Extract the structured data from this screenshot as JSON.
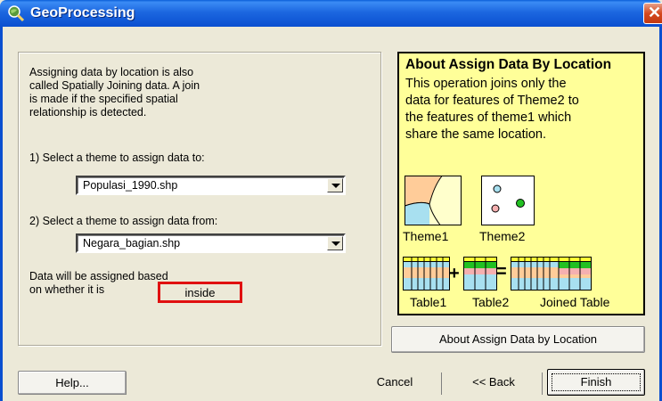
{
  "window": {
    "title": "GeoProcessing",
    "close_glyph": "✕"
  },
  "left_panel": {
    "intro_lines": [
      "Assigning data by location is also",
      "called Spatially Joining data.  A join",
      "is made if the specified spatial",
      "relationship is detected."
    ],
    "step1_label": "1) Select a theme to assign data to:",
    "step1_value": "Populasi_1990.shp",
    "step2_label": "2) Select a theme to assign data from:",
    "step2_value": "Negara_bagian.shp",
    "basis_line1": "Data will be assigned based",
    "basis_line2": "on whether it is",
    "basis_value": "inside"
  },
  "about_panel": {
    "title": "About Assign Data By Location",
    "body_lines": [
      "This operation joins only the",
      "data for features of Theme2 to",
      "the features of theme1 which",
      "share the same location."
    ],
    "theme1_label": "Theme1",
    "theme2_label": "Theme2",
    "table1_label": "Table1",
    "table2_label": "Table2",
    "joined_label": "Joined Table",
    "plus": "+",
    "equals": "=",
    "button_label": "About Assign Data by Location"
  },
  "footer": {
    "help": "Help...",
    "cancel": "Cancel",
    "back": "<< Back",
    "finish": "Finish"
  }
}
